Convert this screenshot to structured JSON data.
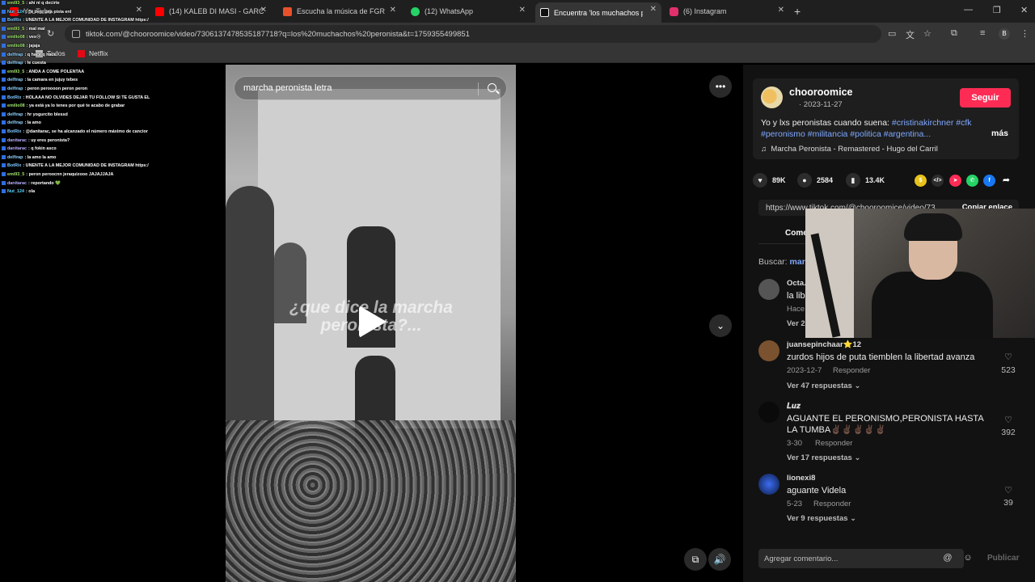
{
  "browser": {
    "tabs": [
      {
        "title": "YouTube",
        "icon": "youtube-icon",
        "color": "#ff0000"
      },
      {
        "title": "(14) KALEB DI MASI - GARC",
        "icon": "youtube-icon",
        "color": "#ff0000"
      },
      {
        "title": "Escucha la música de FGR",
        "icon": "music-icon",
        "color": "#e8512b"
      },
      {
        "title": "(12) WhatsApp",
        "icon": "whatsapp-icon",
        "color": "#25d366"
      },
      {
        "title": "Encuentra 'los muchachos p",
        "icon": "tiktok-icon",
        "color": "#ffffff"
      },
      {
        "title": "(6) Instagram",
        "icon": "instagram-icon",
        "color": "#e1306c"
      }
    ],
    "url": "tiktok.com/@chooroomice/video/7306137478535187718?q=los%20muchachos%20peronista&t=1759355499851",
    "bookmarks": [
      "Todos",
      "Netflix"
    ],
    "profile_initial": "B"
  },
  "chat": [
    {
      "user": "emi93_5",
      "msg": "ahí ni q decirte",
      "color": "#a3e36a"
    },
    {
      "user": "Nut_124",
      "msg": "Te dejo una pista enl",
      "color": "#5fd3ff"
    },
    {
      "user": "BotRix",
      "msg": "UNENTE A LA MEJOR COMUNIDAD DE INSTAGRAM https:/",
      "color": "#7fc8ff"
    },
    {
      "user": "emi93_5",
      "msg": "mal mal",
      "color": "#a3e36a"
    },
    {
      "user": "emilio08",
      "msg": "ves😢",
      "color": "#9fe870"
    },
    {
      "user": "emilio08",
      "msg": "jajaja",
      "color": "#9fe870"
    },
    {
      "user": "delfirap",
      "msg": "q hace q hace",
      "color": "#8fd4ff"
    },
    {
      "user": "delfirap",
      "msg": "le cuesta",
      "color": "#8fd4ff"
    },
    {
      "user": "emi93_5",
      "msg": "ANDA A COME POLENTAA",
      "color": "#a3e36a"
    },
    {
      "user": "delfirap",
      "msg": "la camara en jujuy tebes",
      "color": "#8fd4ff"
    },
    {
      "user": "delfirap",
      "msg": "peron peroooon peron peron",
      "color": "#8fd4ff"
    },
    {
      "user": "BotRix",
      "msg": "HOLAAA NO OLVIDES DEJAR TU FOLLOW SI TE GUSTA EL",
      "color": "#7fc8ff"
    },
    {
      "user": "emilio08",
      "msg": "ya está ya lo tenes por qué te acabo de grabar",
      "color": "#9fe870"
    },
    {
      "user": "delfirap",
      "msg": "hr yogurcito blessd",
      "color": "#8fd4ff"
    },
    {
      "user": "delfirap",
      "msg": "la amo",
      "color": "#8fd4ff"
    },
    {
      "user": "BotRix",
      "msg": "@danitarac, se ha alcanzado el número máximo de cancior",
      "color": "#7fc8ff"
    },
    {
      "user": "danitarac",
      "msg": "uy eres peronista?",
      "color": "#b8b0ff"
    },
    {
      "user": "danitarac",
      "msg": "q fokin asco",
      "color": "#b8b0ff"
    },
    {
      "user": "delfirap",
      "msg": "la amo la amo",
      "color": "#8fd4ff"
    },
    {
      "user": "BotRix",
      "msg": "UNENTE A LA MEJOR COMUNIDAD DE INSTAGRAM https:/",
      "color": "#7fc8ff"
    },
    {
      "user": "emi93_5",
      "msg": "peron peroocnn jeraquizooo JAJAJJAJA",
      "color": "#a3e36a"
    },
    {
      "user": "danitarac",
      "msg": "reportando 💚",
      "color": "#b8b0ff"
    },
    {
      "user": "Nut_124",
      "msg": "ola",
      "color": "#5fd3ff"
    }
  ],
  "video": {
    "search_value": "marcha peronista letra",
    "caption": "¿que dice la marcha peronista?...",
    "more_icon": "•••",
    "down_icon": "⌄"
  },
  "post": {
    "author": "chooroomice",
    "date": "· 2023-11-27",
    "follow_label": "Seguir",
    "desc_text": "Yo y lxs peronistas cuando suena: ",
    "desc_tags": "#cristinakirchner #cfk #peronismo #militancia #politica #argentina...",
    "more_label": "más",
    "music": "Marcha Peronista - Remastered - Hugo del Carril",
    "likes": "89K",
    "comments": "2584",
    "saves": "13.4K",
    "link": "https://www.tiktok.com/@chooroomice/video/73...",
    "copy_label": "Copiar enlace",
    "comments_tab": "Comentarios",
    "search_prefix": "Buscar:",
    "search_term": "marcha peronista"
  },
  "comments": [
    {
      "user": "Octa...",
      "text": "la lib...",
      "meta": "Hace ...",
      "reply": "",
      "replies": "Ver 2...",
      "likes": ""
    },
    {
      "user": "juansepinchaar⭐12",
      "text": "zurdos hijos de puta tiemblen la libertad avanza",
      "meta": "2023-12-7",
      "reply": "Responder",
      "replies": "Ver 47 respuestas ⌄",
      "likes": "523"
    },
    {
      "user": "𝑳𝒖𝒛",
      "text": "AGUANTE EL PERONISMO,PERONISTA HASTA LA TUMBA✌🏿✌🏿✌🏿✌🏿✌🏿",
      "meta": "3-30",
      "reply": "Responder",
      "replies": "Ver 17 respuestas ⌄",
      "likes": "392"
    },
    {
      "user": "lionexi8",
      "text": "aguante Videla",
      "meta": "5-23",
      "reply": "Responder",
      "replies": "Ver 9 respuestas ⌄",
      "likes": "39"
    }
  ],
  "compose": {
    "placeholder": "Agregar comentario...",
    "publish_label": "Publicar"
  }
}
